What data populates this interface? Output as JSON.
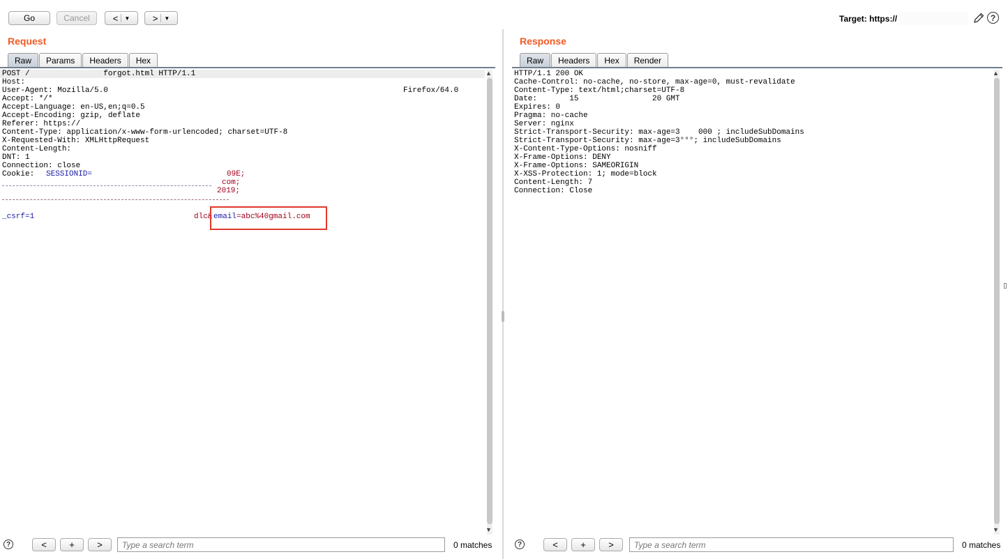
{
  "toolbar": {
    "go_label": "Go",
    "cancel_label": "Cancel",
    "back_label": "<",
    "forward_label": ">",
    "target_label": "Target: https://"
  },
  "request": {
    "title": "Request",
    "tabs": [
      "Raw",
      "Params",
      "Headers",
      "Hex"
    ],
    "active_tab": "Raw",
    "lines": [
      "POST /                forgot.html HTTP/1.1",
      "Host:",
      "User-Agent: Mozilla/5.0",
      "Accept: */*",
      "Accept-Language: en-US,en;q=0.5",
      "Accept-Encoding: gzip, deflate",
      "Referer: https://",
      "Content-Type: application/x-www-form-urlencoded; charset=UTF-8",
      "X-Requested-With: XMLHttpRequest",
      "Content-Length:",
      "DNT: 1",
      "Connection: close"
    ],
    "user_agent_tail": "Firefox/64.0",
    "cookie_label": "Cookie:",
    "cookie_name": "SESSIONID=",
    "cookie_value_tail": "09E;",
    "cookie_line2": "com;",
    "cookie_line3": "2019;",
    "body_param": "_csrf=1",
    "body_mid": "dlc&",
    "body_email_name": "email",
    "body_email_value": "=abc%40gmail.com",
    "search_placeholder": "Type a search term",
    "matches": "0 matches"
  },
  "response": {
    "title": "Response",
    "tabs": [
      "Raw",
      "Headers",
      "Hex",
      "Render"
    ],
    "active_tab": "Raw",
    "lines": [
      "HTTP/1.1 200 OK",
      "Cache-Control: no-cache, no-store, max-age=0, must-revalidate",
      "Content-Type: text/html;charset=UTF-8",
      "Date:       15                20 GMT",
      "Expires: 0",
      "Pragma: no-cache",
      "Server: nginx",
      "Strict-Transport-Security: max-age=3    000 ; includeSubDomains",
      "Strict-Transport-Security: max-age=3°°°; includeSubDomains",
      "X-Content-Type-Options: nosniff",
      "X-Frame-Options: DENY",
      "X-Frame-Options: SAMEORIGIN",
      "X-XSS-Protection: 1; mode=block",
      "Content-Length: 7",
      "Connection: Close"
    ],
    "search_placeholder": "Type a search term",
    "matches": "0 matches"
  },
  "bottom": {
    "help": "?",
    "prev": "<",
    "add": "+",
    "next": ">"
  },
  "icons": {
    "help": "help-icon",
    "edit": "pencil-icon"
  },
  "colors": {
    "panel_title": "#f05a24",
    "highlight_box": "#e0392b",
    "tab_underline": "#6f7e90"
  }
}
